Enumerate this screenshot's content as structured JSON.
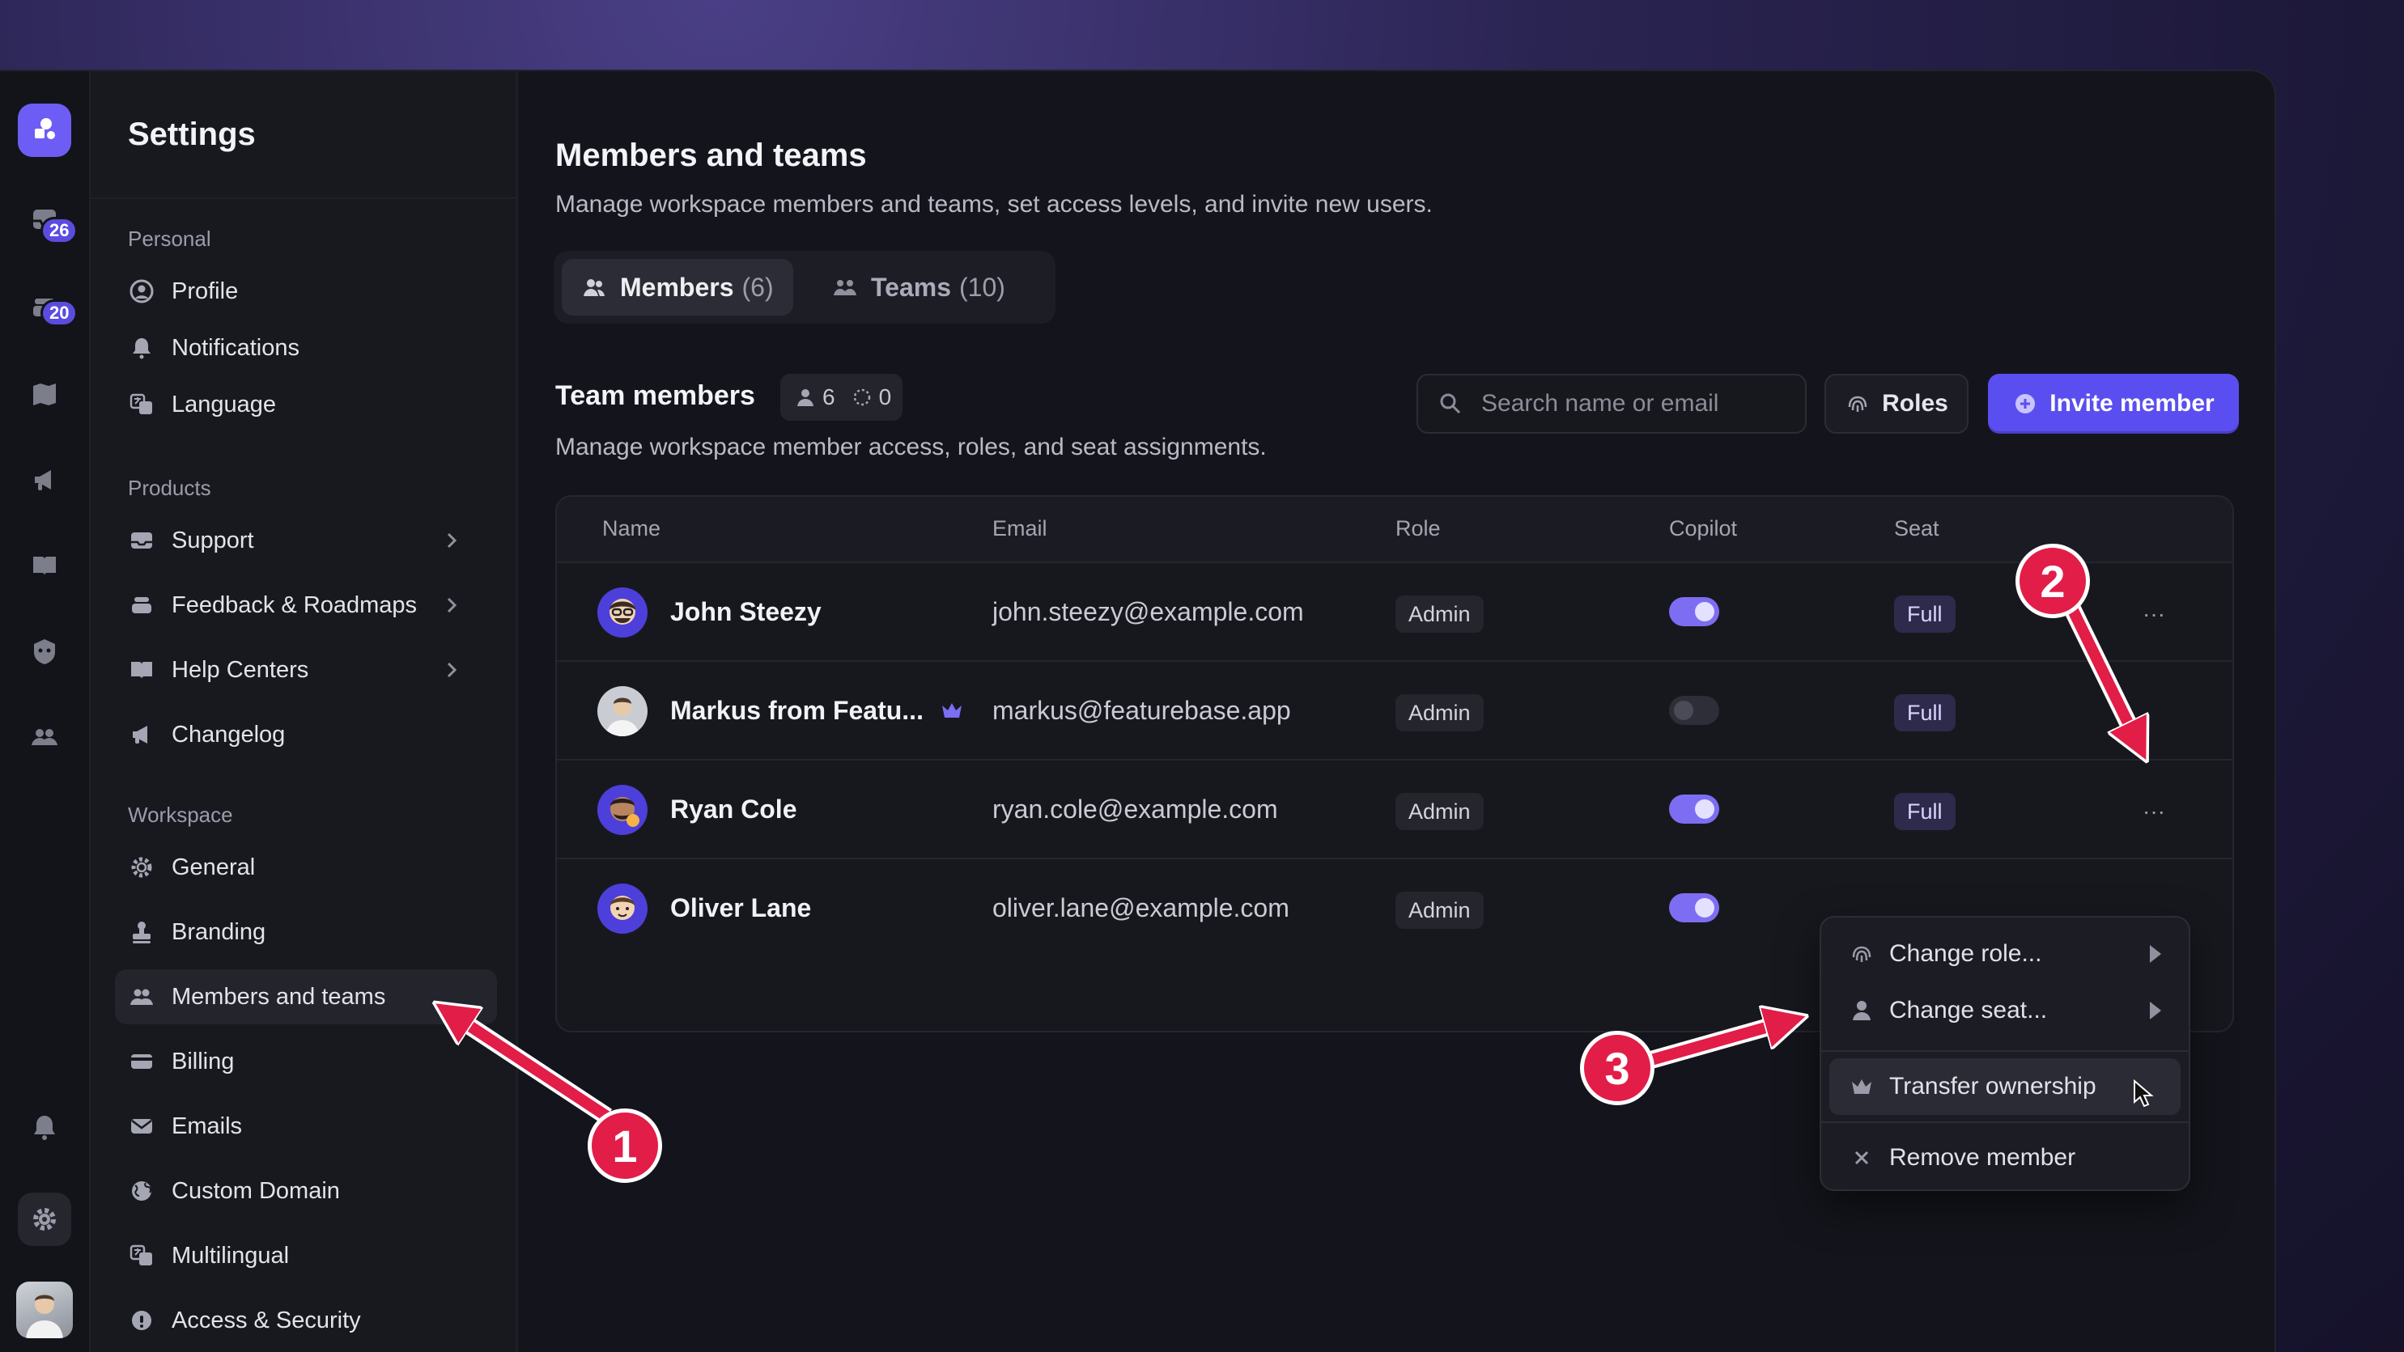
{
  "rail": {
    "inbox_badge": "26",
    "tickets_badge": "20"
  },
  "sidebar": {
    "title": "Settings",
    "personal_label": "Personal",
    "products_label": "Products",
    "workspace_label": "Workspace",
    "personal": [
      {
        "label": "Profile",
        "icon": "user-circle-icon"
      },
      {
        "label": "Notifications",
        "icon": "bell-icon"
      },
      {
        "label": "Language",
        "icon": "translate-icon"
      }
    ],
    "products": [
      {
        "label": "Support",
        "icon": "inbox-icon"
      },
      {
        "label": "Feedback & Roadmaps",
        "icon": "stack-icon"
      },
      {
        "label": "Help Centers",
        "icon": "book-icon"
      },
      {
        "label": "Changelog",
        "icon": "megaphone-icon"
      }
    ],
    "workspace": [
      {
        "label": "General",
        "icon": "gear-icon"
      },
      {
        "label": "Branding",
        "icon": "stamp-icon"
      },
      {
        "label": "Members and teams",
        "icon": "users-icon"
      },
      {
        "label": "Billing",
        "icon": "card-icon"
      },
      {
        "label": "Emails",
        "icon": "envelope-icon"
      },
      {
        "label": "Custom Domain",
        "icon": "globe-icon"
      },
      {
        "label": "Multilingual",
        "icon": "translate-icon"
      },
      {
        "label": "Access & Security",
        "icon": "shield-icon"
      }
    ]
  },
  "main": {
    "title": "Members and teams",
    "subtitle": "Manage workspace members and teams, set access levels, and invite new users.",
    "tabs": [
      {
        "label": "Members",
        "count": "(6)"
      },
      {
        "label": "Teams",
        "count": "(10)"
      }
    ],
    "section_title": "Team members",
    "member_count": "6",
    "pending_count": "0",
    "section_subtitle": "Manage workspace member access, roles, and seat assignments.",
    "search_placeholder": "Search name or email",
    "roles_button": "Roles",
    "invite_button": "Invite member"
  },
  "table": {
    "columns": [
      "Name",
      "Email",
      "Role",
      "Copilot",
      "Seat"
    ],
    "rows": [
      {
        "name": "John Steezy",
        "email": "john.steezy@example.com",
        "role": "Admin",
        "copilot": true,
        "seat": "Full"
      },
      {
        "name": "Markus from Featu...",
        "email": "markus@featurebase.app",
        "role": "Admin",
        "copilot": false,
        "seat": "Full",
        "owner": true
      },
      {
        "name": "Ryan Cole",
        "email": "ryan.cole@example.com",
        "role": "Admin",
        "copilot": true,
        "seat": "Full"
      },
      {
        "name": "Oliver Lane",
        "email": "oliver.lane@example.com",
        "role": "Admin",
        "copilot": true,
        "seat": ""
      }
    ],
    "more_glyph": "···"
  },
  "menu": {
    "change_role": "Change role...",
    "change_seat": "Change seat...",
    "transfer_ownership": "Transfer ownership",
    "remove_member": "Remove member"
  },
  "annotations": {
    "step1": "1",
    "step2": "2",
    "step3": "3",
    "color": "#e11d48"
  },
  "colors": {
    "accent": "#5b4ef0",
    "toggle_on": "#7d6df2",
    "background": "#14151c"
  }
}
